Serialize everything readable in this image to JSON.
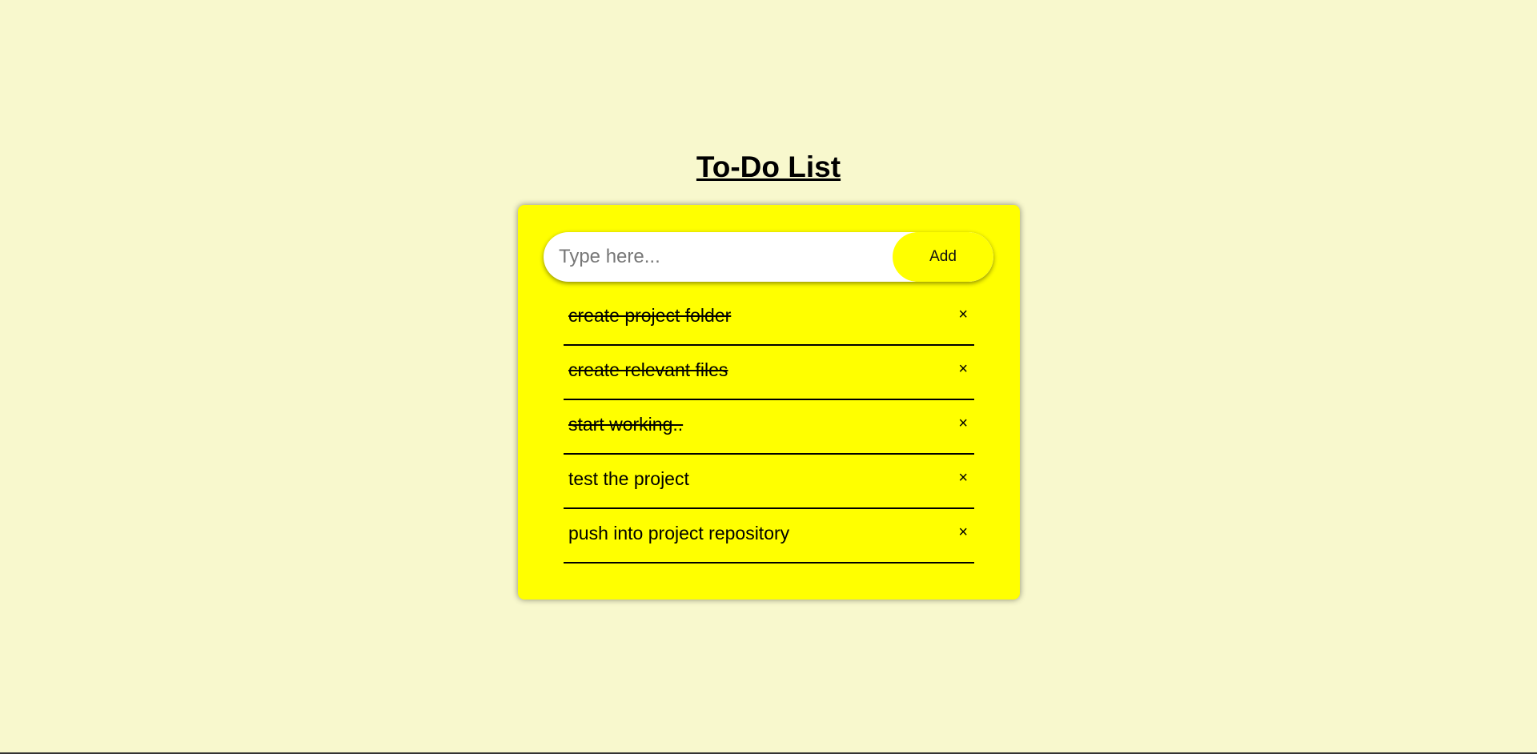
{
  "page": {
    "title": "To-Do List",
    "background_color": "#f8f8cd",
    "card_color": "#ffff00"
  },
  "input": {
    "placeholder": "Type here...",
    "value": ""
  },
  "add_button": {
    "label": "Add"
  },
  "tasks": [
    {
      "text": "create project folder",
      "done": true,
      "remove_label": "×"
    },
    {
      "text": "create relevant files",
      "done": true,
      "remove_label": "×"
    },
    {
      "text": "start working..",
      "done": true,
      "remove_label": "×"
    },
    {
      "text": "test the project",
      "done": false,
      "remove_label": "×"
    },
    {
      "text": "push into project repository",
      "done": false,
      "remove_label": "×"
    }
  ]
}
